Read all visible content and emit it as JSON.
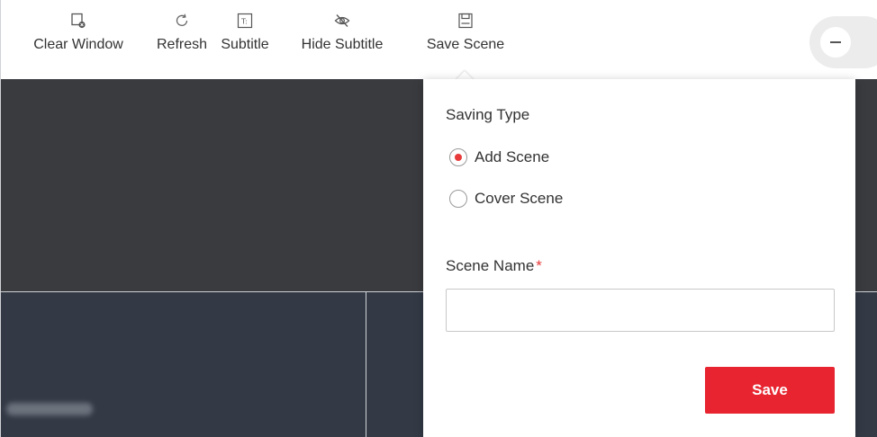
{
  "toolbar": {
    "items": [
      {
        "label": "Clear Window",
        "icon": "clear-window-icon"
      },
      {
        "label": "Refresh",
        "icon": "refresh-icon"
      },
      {
        "label": "Subtitle",
        "icon": "subtitle-icon"
      },
      {
        "label": "Hide Subtitle",
        "icon": "hide-icon"
      },
      {
        "label": "Save Scene",
        "icon": "save-icon"
      }
    ],
    "collapse_icon": "minus-icon"
  },
  "popover": {
    "saving_type_label": "Saving Type",
    "options": [
      {
        "label": "Add Scene",
        "selected": true
      },
      {
        "label": "Cover Scene",
        "selected": false
      }
    ],
    "scene_name_label": "Scene Name",
    "required_mark": "*",
    "scene_name_value": "",
    "save_label": "Save"
  },
  "colors": {
    "accent": "#e7242f",
    "wall_bg": "#3a3b3f",
    "cell_bg": "#333a46"
  }
}
